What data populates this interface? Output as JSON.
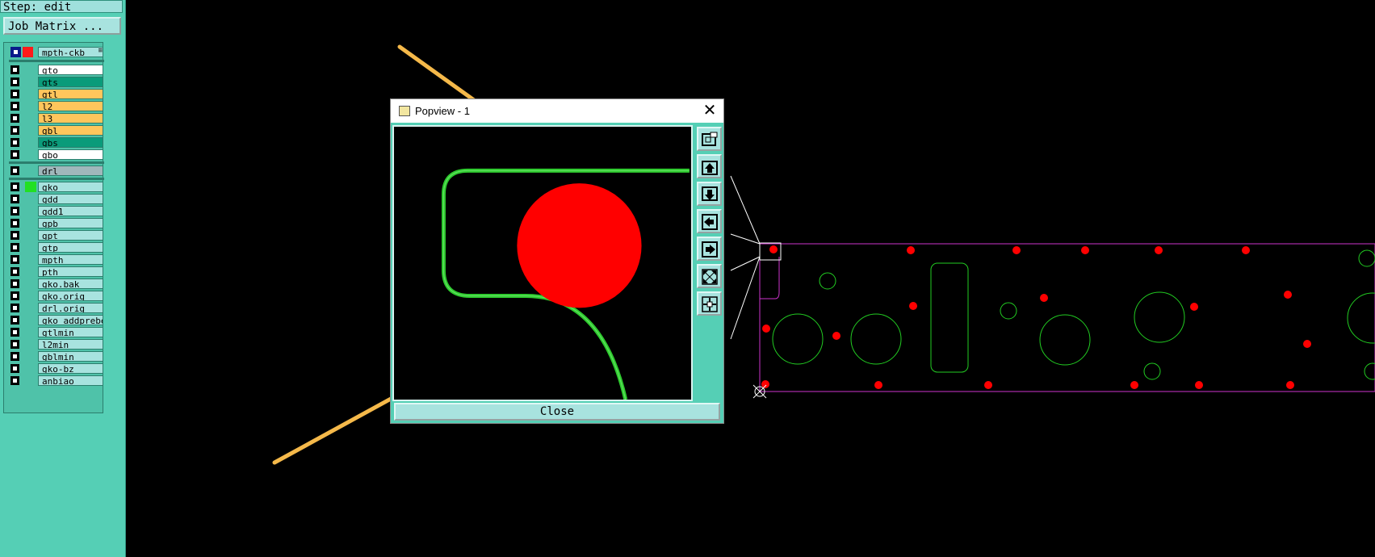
{
  "left_panel": {
    "step_title": "Step: edit",
    "job_matrix_label": "Job Matrix ...",
    "step_layer": "mpth-ckb",
    "layer_groups": [
      [
        {
          "name": "gto",
          "color": "#ffffff"
        },
        {
          "name": "gts",
          "color": "#0a9b7a"
        },
        {
          "name": "gtl",
          "color": "#ffc65c"
        },
        {
          "name": "l2",
          "color": "#ffc65c"
        },
        {
          "name": "l3",
          "color": "#ffc65c"
        },
        {
          "name": "gbl",
          "color": "#ffc65c"
        },
        {
          "name": "gbs",
          "color": "#0a9b7a"
        },
        {
          "name": "gbo",
          "color": "#ffffff"
        }
      ],
      [
        {
          "name": "drl",
          "color": "#a0b7bb"
        }
      ],
      [
        {
          "name": "gko",
          "color": "#a8e3df",
          "swatch": "#22e022"
        },
        {
          "name": "gdd",
          "color": "#a8e3df"
        },
        {
          "name": "gdd1",
          "color": "#a8e3df"
        },
        {
          "name": "gpb",
          "color": "#a8e3df"
        },
        {
          "name": "gpt",
          "color": "#a8e3df"
        },
        {
          "name": "gtp",
          "color": "#a8e3df"
        },
        {
          "name": "mpth",
          "color": "#a8e3df"
        },
        {
          "name": "pth",
          "color": "#a8e3df"
        },
        {
          "name": "gko.bak",
          "color": "#a8e3df"
        },
        {
          "name": "gko.orig",
          "color": "#a8e3df"
        },
        {
          "name": "drl.orig",
          "color": "#a8e3df"
        },
        {
          "name": "gko_addprebe",
          "color": "#a8e3df"
        },
        {
          "name": "gtlmin",
          "color": "#a8e3df"
        },
        {
          "name": "l2min",
          "color": "#a8e3df"
        },
        {
          "name": "gblmin",
          "color": "#a8e3df"
        },
        {
          "name": "gko-bz",
          "color": "#a8e3df"
        },
        {
          "name": "anbiao",
          "color": "#a8e3df"
        }
      ]
    ]
  },
  "popview": {
    "title": "Popview - 1",
    "close_glyph": "✕",
    "close_label": "Close",
    "tools": [
      "zoom-window-icon",
      "pan-up-icon",
      "pan-down-icon",
      "pan-left-icon",
      "pan-right-icon",
      "zoom-fit-icon",
      "center-icon"
    ]
  },
  "colors": {
    "panel_bg": "#55cfb5",
    "outline_green": "#2ecc2e",
    "pad_red": "#ff0000",
    "profile_magenta": "#cc33cc",
    "annotation_arrow": "#f5b94a"
  }
}
